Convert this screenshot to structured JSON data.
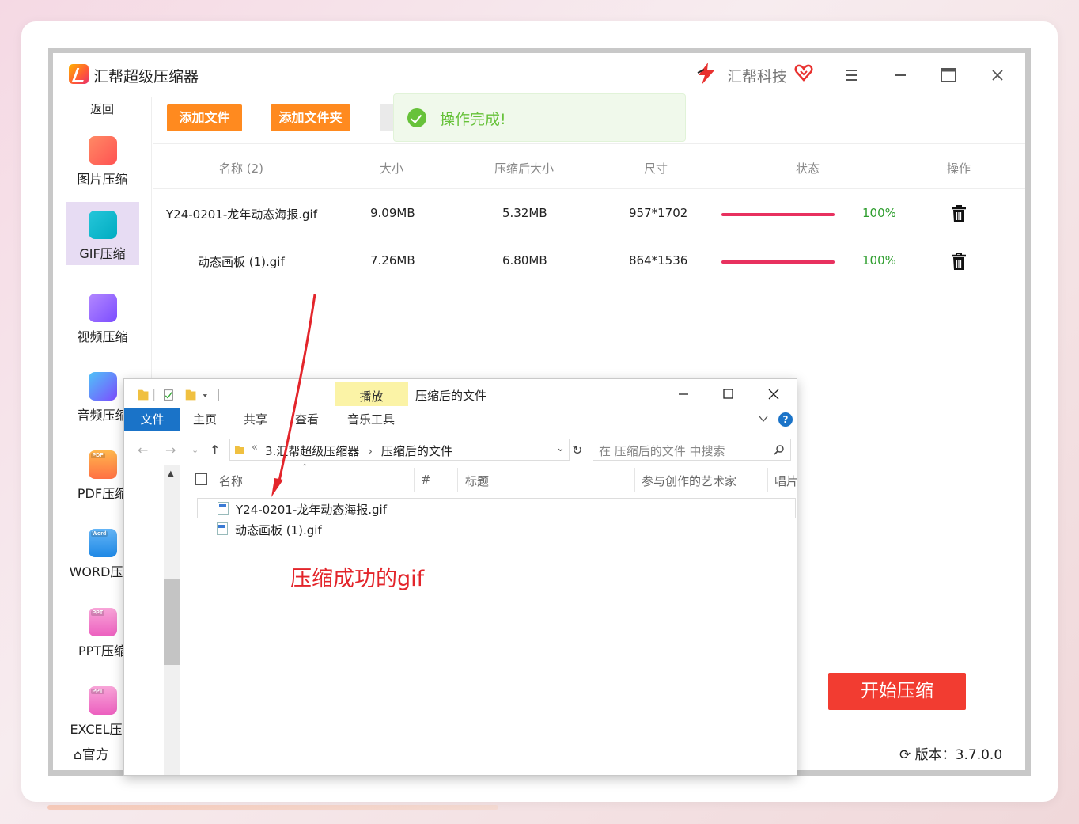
{
  "app": {
    "title": "汇帮超级压缩器",
    "brand": "汇帮科技",
    "back": "返回",
    "official": "官方",
    "version": "版本：3.7.0.0",
    "start_button": "开始压缩"
  },
  "sidebar": {
    "items": [
      {
        "label": "图片压缩",
        "icon": "image-icon"
      },
      {
        "label": "GIF压缩",
        "icon": "gif-icon"
      },
      {
        "label": "视频压缩",
        "icon": "video-icon"
      },
      {
        "label": "音频压缩",
        "icon": "audio-icon"
      },
      {
        "label": "PDF压缩",
        "icon": "pdf-icon",
        "tag": "PDF"
      },
      {
        "label": "WORD压缩",
        "icon": "word-icon",
        "tag": "Word"
      },
      {
        "label": "PPT压缩",
        "icon": "ppt-icon",
        "tag": "PPT"
      },
      {
        "label": "EXCEL压缩",
        "icon": "excel-icon",
        "tag": "PPT"
      }
    ]
  },
  "toolbar": {
    "add_file": "添加文件",
    "add_folder": "添加文件夹"
  },
  "toast": {
    "text": "操作完成!"
  },
  "table": {
    "headers": [
      "名称 (2)",
      "大小",
      "压缩后大小",
      "尺寸",
      "状态",
      "操作"
    ],
    "rows": [
      {
        "name": "Y24-0201-龙年动态海报.gif",
        "size": "9.09MB",
        "compressed": "5.32MB",
        "dims": "957*1702",
        "status": "100%",
        "progress": 1.0
      },
      {
        "name": "动态画板 (1).gif",
        "size": "7.26MB",
        "compressed": "6.80MB",
        "dims": "864*1536",
        "status": "100%",
        "progress": 1.0
      }
    ]
  },
  "explorer": {
    "context_tab": "播放",
    "window_title": "压缩后的文件",
    "tabs": [
      "文件",
      "主页",
      "共享",
      "查看",
      "音乐工具"
    ],
    "breadcrumb_prefix": "«",
    "breadcrumb": [
      "3.汇帮超级压缩器",
      "压缩后的文件"
    ],
    "search_placeholder": "在 压缩后的文件 中搜索",
    "columns": [
      "名称",
      "#",
      "标题",
      "参与创作的艺术家",
      "唱片"
    ],
    "files": [
      "Y24-0201-龙年动态海报.gif",
      "动态画板 (1).gif"
    ]
  },
  "annotation": "压缩成功的gif",
  "colors": {
    "accent_orange": "#ff8a1f",
    "start_red": "#f23c31",
    "progress": "#e8315f",
    "success_green": "#67c23a",
    "annotation_red": "#e3252b"
  }
}
